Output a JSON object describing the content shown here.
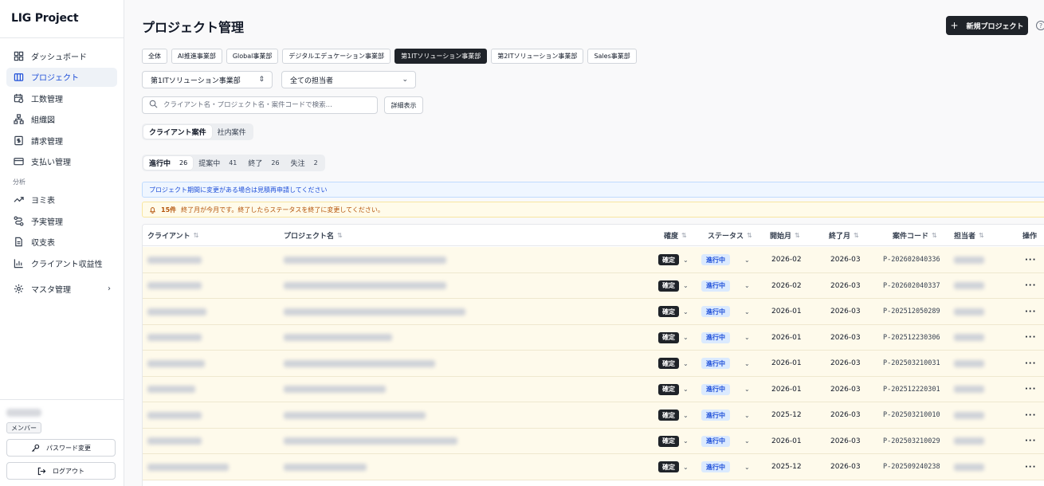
{
  "brand": "LIG Project",
  "nav": [
    {
      "label": "ダッシュボード",
      "icon": "dashboard-icon"
    },
    {
      "label": "プロジェクト",
      "icon": "project-icon",
      "active": true
    },
    {
      "label": "工数管理",
      "icon": "calendar-clock-icon"
    },
    {
      "label": "組織図",
      "icon": "org-chart-icon"
    },
    {
      "label": "請求管理",
      "icon": "invoice-icon"
    },
    {
      "label": "支払い管理",
      "icon": "card-icon"
    }
  ],
  "nav_section": "分析",
  "nav2": [
    {
      "label": "ヨミ表",
      "icon": "trend-icon"
    },
    {
      "label": "予実管理",
      "icon": "route-icon"
    },
    {
      "label": "収支表",
      "icon": "document-icon"
    },
    {
      "label": "クライアント収益性",
      "icon": "bar-chart-icon"
    },
    {
      "label": "マスタ管理",
      "icon": "gear-icon"
    }
  ],
  "user": {
    "role": "メンバー"
  },
  "side_buttons": {
    "password": "パスワード変更",
    "logout": "ログアウト"
  },
  "header": {
    "title": "プロジェクト管理",
    "new_button": "新規プロジェクト",
    "help": "?"
  },
  "dept_tabs": [
    "全体",
    "AI推進事業部",
    "Global事業部",
    "デジタルエデュケーション事業部",
    "第1ITソリューション事業部",
    "第2ITソリューション事業部",
    "Sales事業部"
  ],
  "dept_active": 4,
  "filters": {
    "department": "第1ITソリューション事業部",
    "assignee": "全ての担当者"
  },
  "search": {
    "placeholder": "クライアント名・プロジェクト名・案件コードで検索..."
  },
  "detail_button": "詳細表示",
  "case_tabs": [
    "クライアント案件",
    "社内案件"
  ],
  "status_tabs": [
    {
      "label": "進行中",
      "count": "26"
    },
    {
      "label": "提案中",
      "count": "41"
    },
    {
      "label": "終了",
      "count": "26"
    },
    {
      "label": "失注",
      "count": "2"
    }
  ],
  "notice_blue": "プロジェクト期間に変更がある場合は見積再申請してください",
  "notice_yellow": {
    "count": "15件",
    "text": "終了月が今月です。終了したらステータスを終了に変更してください。"
  },
  "table": {
    "headers": {
      "client": "クライアント",
      "project": "プロジェクト名",
      "confirm": "確度",
      "status": "ステータス",
      "start": "開始月",
      "end": "終了月",
      "code": "案件コード",
      "owner": "担当者",
      "action": "操作"
    },
    "sort_icon": "⇅",
    "rows": [
      {
        "confirm": "確定",
        "status": "進行中",
        "start": "2026-02",
        "end": "2026-03",
        "code": "P-202602040336"
      },
      {
        "confirm": "確定",
        "status": "進行中",
        "start": "2026-02",
        "end": "2026-03",
        "code": "P-202602040337"
      },
      {
        "confirm": "確定",
        "status": "進行中",
        "start": "2026-01",
        "end": "2026-03",
        "code": "P-202512050289"
      },
      {
        "confirm": "確定",
        "status": "進行中",
        "start": "2026-01",
        "end": "2026-03",
        "code": "P-202512230306"
      },
      {
        "confirm": "確定",
        "status": "進行中",
        "start": "2026-01",
        "end": "2026-03",
        "code": "P-202503210031"
      },
      {
        "confirm": "確定",
        "status": "進行中",
        "start": "2026-01",
        "end": "2026-03",
        "code": "P-202512220301"
      },
      {
        "confirm": "確定",
        "status": "進行中",
        "start": "2025-12",
        "end": "2026-03",
        "code": "P-202503210010"
      },
      {
        "confirm": "確定",
        "status": "進行中",
        "start": "2026-01",
        "end": "2026-03",
        "code": "P-202503210029"
      },
      {
        "confirm": "確定",
        "status": "進行中",
        "start": "2025-12",
        "end": "2026-03",
        "code": "P-202509240238"
      }
    ]
  }
}
